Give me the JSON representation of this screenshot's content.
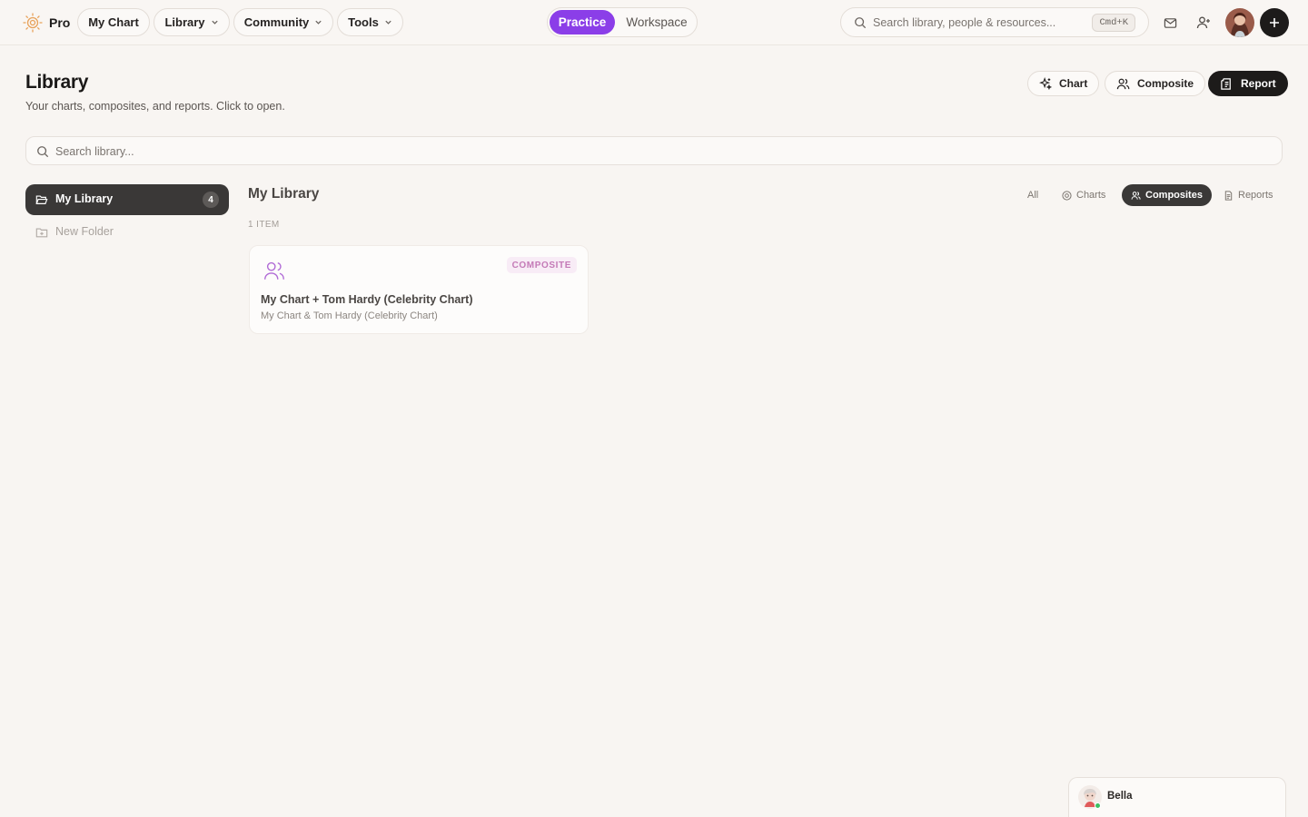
{
  "topbar": {
    "brand": {
      "name": "Pro",
      "icon": "sun-logo-icon"
    },
    "nav": [
      {
        "label": "My Chart",
        "has_dropdown": false
      },
      {
        "label": "Library",
        "has_dropdown": true
      },
      {
        "label": "Community",
        "has_dropdown": true
      },
      {
        "label": "Tools",
        "has_dropdown": true
      }
    ],
    "mode": {
      "active": "Practice",
      "inactive": "Workspace"
    },
    "search": {
      "placeholder": "Search library, people & resources...",
      "shortcut": "Cmd+K"
    },
    "icons": [
      "mail-icon",
      "add-user-icon",
      "avatar",
      "plus-icon"
    ]
  },
  "header": {
    "title": "Library",
    "subtitle": "Your charts, composites, and reports. Click to open.",
    "actions": [
      {
        "label": "Chart",
        "icon": "sparkle-icon",
        "style": "outline"
      },
      {
        "label": "Composite",
        "icon": "users-icon",
        "style": "outline"
      },
      {
        "label": "Report",
        "icon": "report-icon",
        "style": "dark"
      }
    ]
  },
  "library_search": {
    "placeholder": "Search library..."
  },
  "sidebar": {
    "items": [
      {
        "label": "My Library",
        "count": "4",
        "active": true
      },
      {
        "label": "New Folder",
        "active": false
      }
    ]
  },
  "content": {
    "title": "My Library",
    "item_count": "1 ITEM",
    "filters": [
      {
        "label": "All",
        "active": false
      },
      {
        "label": "Charts",
        "active": false
      },
      {
        "label": "Composites",
        "active": true
      },
      {
        "label": "Reports",
        "active": false
      }
    ],
    "cards": [
      {
        "type_badge": "COMPOSITE",
        "title": "My Chart + Tom Hardy (Celebrity Chart)",
        "subtitle": "My Chart & Tom Hardy (Celebrity Chart)"
      }
    ]
  },
  "chat": {
    "name": "Bella",
    "status": "online"
  },
  "colors": {
    "accent": "#8b3ee8",
    "dark": "#1d1b1a",
    "background": "#f8f5f2",
    "badge_text": "#c47ab7"
  }
}
